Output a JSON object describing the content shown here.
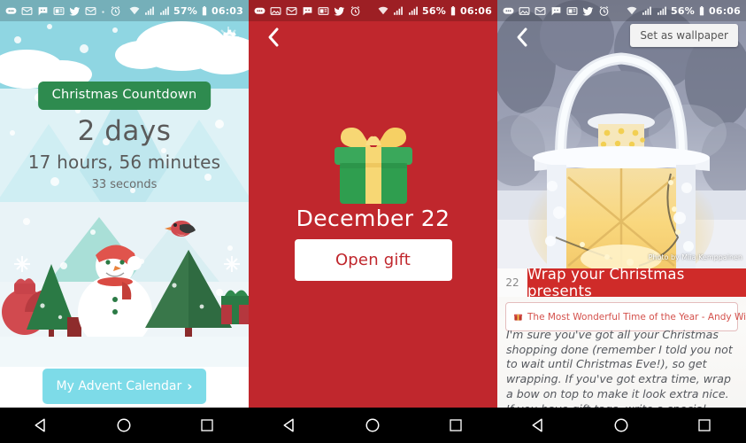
{
  "statusbars": [
    {
      "icons": [
        "chat-icon",
        "gmail-icon",
        "messenger-icon",
        "news-icon",
        "twitter-icon",
        "gmail-icon",
        "dot-icon",
        "alarm-icon",
        "wifi-icon",
        "signal-1-icon",
        "signal-2-icon"
      ],
      "battery": "57%",
      "time": "06:03"
    },
    {
      "icons": [
        "chat-icon",
        "photo-icon",
        "gmail-icon",
        "messenger-icon",
        "news-icon",
        "twitter-icon",
        "alarm-icon",
        "wifi-icon",
        "signal-1-icon",
        "signal-2-icon"
      ],
      "battery": "56%",
      "time": "06:06"
    },
    {
      "icons": [
        "chat-icon",
        "photo-icon",
        "gmail-icon",
        "messenger-icon",
        "news-icon",
        "twitter-icon",
        "alarm-icon",
        "wifi-icon",
        "signal-1-icon",
        "signal-2-icon"
      ],
      "battery": "56%",
      "time": "06:06"
    }
  ],
  "countdown": {
    "badge": "Christmas Countdown",
    "days": "2 days",
    "hours": "17 hours, 56 minutes",
    "seconds": "33 seconds",
    "advent_button": "My Advent Calendar",
    "advent_chevron": "›",
    "share_icon": "share-icon",
    "settings_icon": "gear-icon",
    "colors": {
      "sky": "#8fd6e2",
      "badge": "#2e8b4f",
      "button": "#7ddbe8"
    }
  },
  "gift": {
    "back_icon": "chevron-left-icon",
    "gift_icon": "gift-box-icon",
    "date": "December 22",
    "open_button": "Open gift",
    "colors": {
      "background": "#c0272d",
      "box": "#2f9e4f",
      "ribbon": "#f7d774"
    }
  },
  "advent": {
    "back_icon": "chevron-left-icon",
    "wallpaper_button": "Set as wallpaper",
    "photo_credit": "Photo by Miia Kemppainen",
    "photo_subject": "frosted-lantern-photo",
    "day_number": "22",
    "title": "Wrap your Christmas presents",
    "song_icon": "music-gift-icon",
    "song": "The Most Wonderful Time of the Year - Andy Williams",
    "body": "I'm sure you've got all your Christmas shopping done (remember I told you not to wait until Christmas Eve!), so get wrapping. If you've got extra time, wrap a bow on top to make it look extra nice. If you have gift tags, write a special message to brighten your giftee's day!",
    "colors": {
      "title_bar": "#cf2b29",
      "song_text": "#d4514c"
    }
  },
  "navbar": {
    "back_icon": "nav-back-triangle-icon",
    "home_icon": "nav-home-circle-icon",
    "recents_icon": "nav-recents-square-icon"
  }
}
